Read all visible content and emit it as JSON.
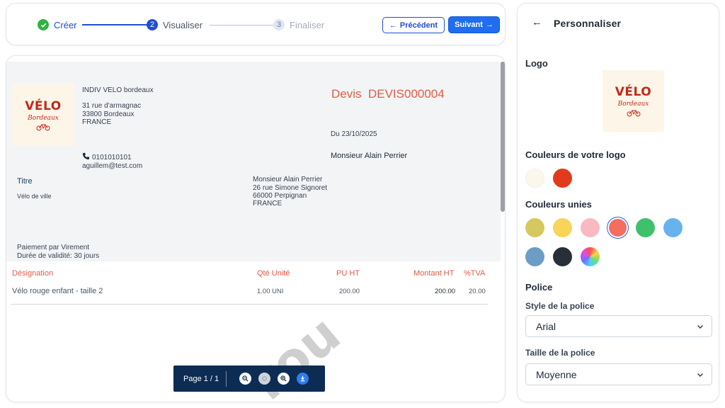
{
  "stepper": {
    "steps": [
      {
        "number": "✓",
        "label": "Créer",
        "state": "done"
      },
      {
        "number": "2",
        "label": "Visualiser",
        "state": "active"
      },
      {
        "number": "3",
        "label": "Finaliser",
        "state": "pending"
      }
    ],
    "prev_label": "Précédent",
    "next_label": "Suivant"
  },
  "document": {
    "company_name": "INDIV VELO bordeaux",
    "company_address": [
      "31 rue d'armagnac",
      "33800 Bordeaux",
      "FRANCE"
    ],
    "phone": "0101010101",
    "email": "aguillem@test.com",
    "logo_text": "VÉLO",
    "logo_subtext": "Bordeaux",
    "doc_type": "Devis",
    "doc_number": "DEVIS000004",
    "date": "Du 23/10/2025",
    "client_name": "Monsieur Alain Perrier",
    "title_label": "Titre",
    "title_value": "Vélo de ville",
    "client_address": [
      "Monsieur Alain Perrier",
      "26 rue Simone Signoret",
      "66000 Perpignan",
      "FRANCE"
    ],
    "payment": "Paiement par Virement",
    "validity": "Durée de validité: 30 jours",
    "table": {
      "headers": {
        "designation": "Désignation",
        "qty": "Qté Unité",
        "pu": "PU HT",
        "montant": "Montant HT",
        "tva": "%TVA"
      },
      "rows": [
        {
          "designation": "Vélo rouge enfant - taille 2",
          "qty": "1.00 UNI",
          "pu": "200.00",
          "montant": "200.00",
          "tva": "20.00"
        }
      ]
    },
    "watermark": "rou"
  },
  "pdf_toolbar": {
    "page_label": "Page 1 / 1",
    "icons": [
      "zoom-out-icon",
      "zoom-reset-icon",
      "zoom-in-icon",
      "download-icon"
    ]
  },
  "panel": {
    "title": "Personnaliser",
    "logo_section": "Logo",
    "logo_colors_section": "Couleurs de votre logo",
    "logo_colors": [
      "#fbf7ea",
      "#e23b1c"
    ],
    "solid_colors_section": "Couleurs unies",
    "solid_colors": [
      "#d6c85e",
      "#f7d55a",
      "#f8b9c2",
      "#f56d5e",
      "#3fc06a",
      "#68b3ee",
      "#6b9dc6",
      "#273036"
    ],
    "selected_solid_color": "#f56d5e",
    "font_section": "Police",
    "font_style_label": "Style de la police",
    "font_style_value": "Arial",
    "font_size_label": "Taille de la police",
    "font_size_value": "Moyenne"
  },
  "colors": {
    "accent": "#1e4fd1",
    "doc_accent": "#e25b45",
    "toolbar": "#0c2c54"
  }
}
